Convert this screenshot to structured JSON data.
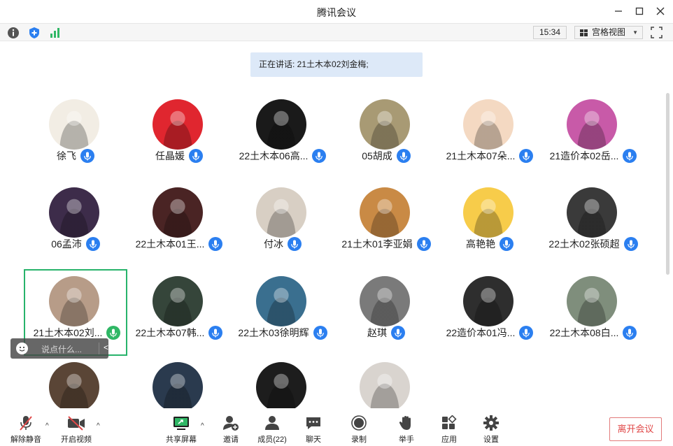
{
  "window": {
    "title": "腾讯会议"
  },
  "infobar": {
    "clock": "15:34",
    "view_mode": "宫格视图"
  },
  "speaking": {
    "text": "正在讲话: 21土木本02刘金梅;"
  },
  "participants": [
    {
      "name": "徐飞",
      "avatar_color": "#f2ede4"
    },
    {
      "name": "任晶媛",
      "avatar_color": "#e0262f"
    },
    {
      "name": "22土木本06高...",
      "avatar_color": "#1a1a1a"
    },
    {
      "name": "05胡成",
      "avatar_color": "#a89a74"
    },
    {
      "name": "21土木本07朵...",
      "avatar_color": "#f4d9c2"
    },
    {
      "name": "21造价本02岳...",
      "avatar_color": "#c85aa8"
    },
    {
      "name": "06孟沛",
      "avatar_color": "#3d2c4a"
    },
    {
      "name": "22土木本01王...",
      "avatar_color": "#4a2424"
    },
    {
      "name": "付冰",
      "avatar_color": "#d8cfc4"
    },
    {
      "name": "21土木01李亚娟",
      "avatar_color": "#c98a45"
    },
    {
      "name": "高艳艳",
      "avatar_color": "#f7cc4a"
    },
    {
      "name": "22土木02张硕超",
      "avatar_color": "#3a3a3a"
    },
    {
      "name": "21土木本02刘...",
      "avatar_color": "#b79c88",
      "active": true
    },
    {
      "name": "22土木本07韩...",
      "avatar_color": "#35453a"
    },
    {
      "name": "22土木03徐明辉",
      "avatar_color": "#3a6f8f"
    },
    {
      "name": "赵琪",
      "avatar_color": "#7a7a7a"
    },
    {
      "name": "22造价本01冯...",
      "avatar_color": "#2e2e2e"
    },
    {
      "name": "22土木本08白...",
      "avatar_color": "#7f8e7c"
    },
    {
      "name": "",
      "avatar_color": "#5a4536"
    },
    {
      "name": "",
      "avatar_color": "#2a3a4e"
    },
    {
      "name": "",
      "avatar_color": "#1d1d1d"
    },
    {
      "name": "",
      "avatar_color": "#d9d4cf"
    }
  ],
  "chat": {
    "placeholder": "说点什么..."
  },
  "toolbar": {
    "unmute": "解除静音",
    "start_video": "开启视频",
    "share_screen": "共享屏幕",
    "invite": "邀请",
    "members": "成员(22)",
    "chat": "聊天",
    "record": "录制",
    "raise_hand": "举手",
    "apps": "应用",
    "settings": "设置",
    "leave": "离开会议"
  },
  "colors": {
    "accent": "#2b7ff0",
    "speaking_bg": "#dde9f8",
    "active_border": "#27b36b",
    "leave_red": "#e04848"
  }
}
